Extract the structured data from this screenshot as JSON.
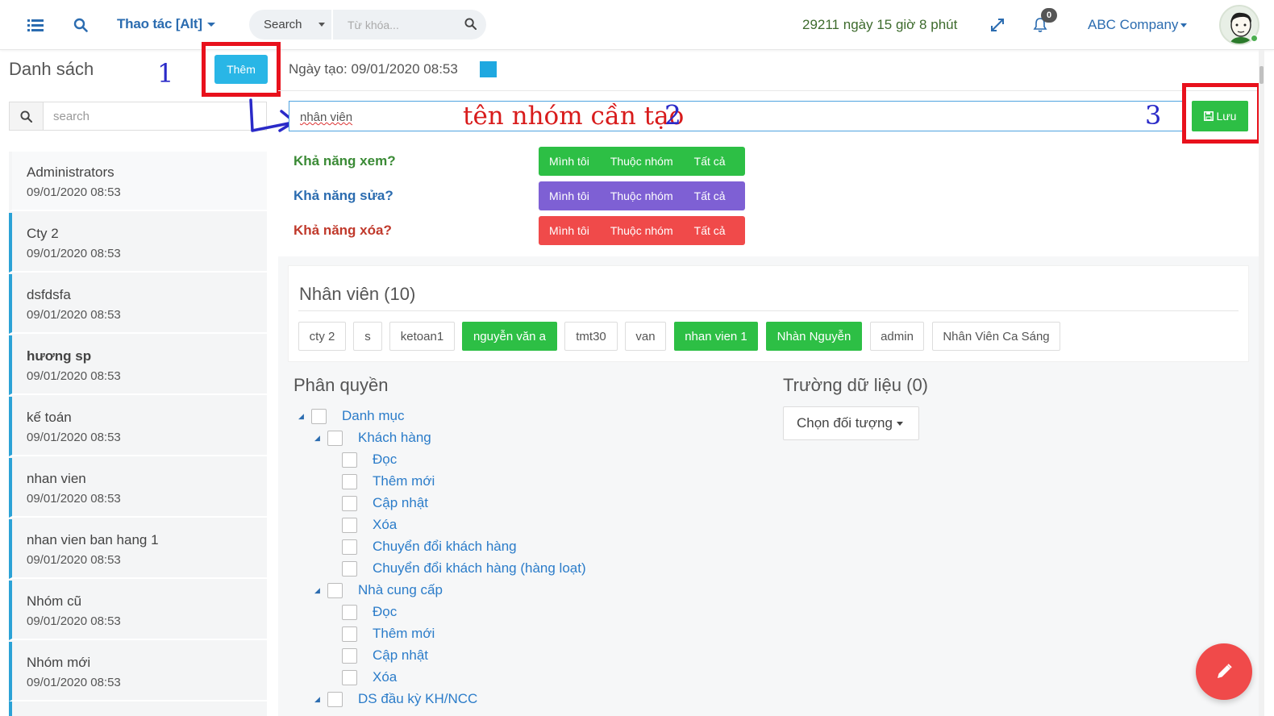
{
  "header": {
    "menu_icon": "list-menu-icon",
    "search_icon": "magnifier-icon",
    "thao_tac_label": "Thao tác [Alt]",
    "search_select_label": "Search",
    "keyword_placeholder": "Từ khóa...",
    "countdown_text": "29211 ngày 15 giờ 8 phút",
    "expand_icon": "expand-arrows-icon",
    "bell_icon": "bell-icon",
    "notification_count": "0",
    "company_label": "ABC Company"
  },
  "left": {
    "title": "Danh sách",
    "add_button_label": "Thêm",
    "search_placeholder": "search",
    "items": [
      {
        "name": "Administrators",
        "date": "09/01/2020 08:53"
      },
      {
        "name": "Cty 2",
        "date": "09/01/2020 08:53"
      },
      {
        "name": "dsfdsfa",
        "date": "09/01/2020 08:53"
      },
      {
        "name": "hương sp",
        "date": "09/01/2020 08:53"
      },
      {
        "name": "kế toán",
        "date": "09/01/2020 08:53"
      },
      {
        "name": "nhan vien",
        "date": "09/01/2020 08:53"
      },
      {
        "name": "nhan vien ban hang 1",
        "date": "09/01/2020 08:53"
      },
      {
        "name": "Nhóm cũ",
        "date": "09/01/2020 08:53"
      },
      {
        "name": "Nhóm mới",
        "date": "09/01/2020 08:53"
      }
    ]
  },
  "annotations": {
    "step1": "1",
    "step2": "2",
    "step3": "3",
    "note": "tên nhóm cần tạo"
  },
  "main": {
    "created_label": "Ngày tạo: 09/01/2020 08:53",
    "name_value": "nhân viên",
    "save_label": "Lưu",
    "perms": [
      {
        "label": "Khả năng xem?",
        "color": "#3a8a35",
        "btn_color": "#2dbf45",
        "opts": [
          "Mình tôi",
          "Thuộc nhóm",
          "Tất cả"
        ]
      },
      {
        "label": "Khả năng sửa?",
        "color": "#2b6cb0",
        "btn_color": "#7e60d4",
        "opts": [
          "Mình tôi",
          "Thuộc nhóm",
          "Tất cả"
        ]
      },
      {
        "label": "Khả năng xóa?",
        "color": "#c0392b",
        "btn_color": "#f04a4a",
        "opts": [
          "Mình tôi",
          "Thuộc nhóm",
          "Tất cả"
        ]
      }
    ],
    "employees_title": "Nhân viên (10)",
    "employees": [
      {
        "name": "cty 2",
        "selected": false
      },
      {
        "name": "s",
        "selected": false
      },
      {
        "name": "ketoan1",
        "selected": false
      },
      {
        "name": "nguyễn văn a",
        "selected": true
      },
      {
        "name": "tmt30",
        "selected": false
      },
      {
        "name": "van",
        "selected": false
      },
      {
        "name": "nhan vien 1",
        "selected": true
      },
      {
        "name": "Nhàn Nguyễn",
        "selected": true
      },
      {
        "name": "admin",
        "selected": false
      },
      {
        "name": "Nhân Viên Ca Sáng",
        "selected": false
      }
    ],
    "permissions_title": "Phân quyền",
    "fields_title": "Trường dữ liệu (0)",
    "choose_object_label": "Chọn đối tượng",
    "tree": [
      {
        "label": "Danh mục",
        "level": 0,
        "expandable": true
      },
      {
        "label": "Khách hàng",
        "level": 1,
        "expandable": true
      },
      {
        "label": "Đọc",
        "level": 2,
        "expandable": false
      },
      {
        "label": "Thêm mới",
        "level": 2,
        "expandable": false
      },
      {
        "label": "Cập nhật",
        "level": 2,
        "expandable": false
      },
      {
        "label": "Xóa",
        "level": 2,
        "expandable": false
      },
      {
        "label": "Chuyển đổi khách hàng",
        "level": 2,
        "expandable": false
      },
      {
        "label": "Chuyển đổi khách hàng (hàng loạt)",
        "level": 2,
        "expandable": false
      },
      {
        "label": "Nhà cung cấp",
        "level": 1,
        "expandable": true
      },
      {
        "label": "Đọc",
        "level": 2,
        "expandable": false
      },
      {
        "label": "Thêm mới",
        "level": 2,
        "expandable": false
      },
      {
        "label": "Cập nhật",
        "level": 2,
        "expandable": false
      },
      {
        "label": "Xóa",
        "level": 2,
        "expandable": false
      },
      {
        "label": "DS đầu kỳ KH/NCC",
        "level": 1,
        "expandable": true
      }
    ],
    "fab_icon": "pencil-icon"
  }
}
